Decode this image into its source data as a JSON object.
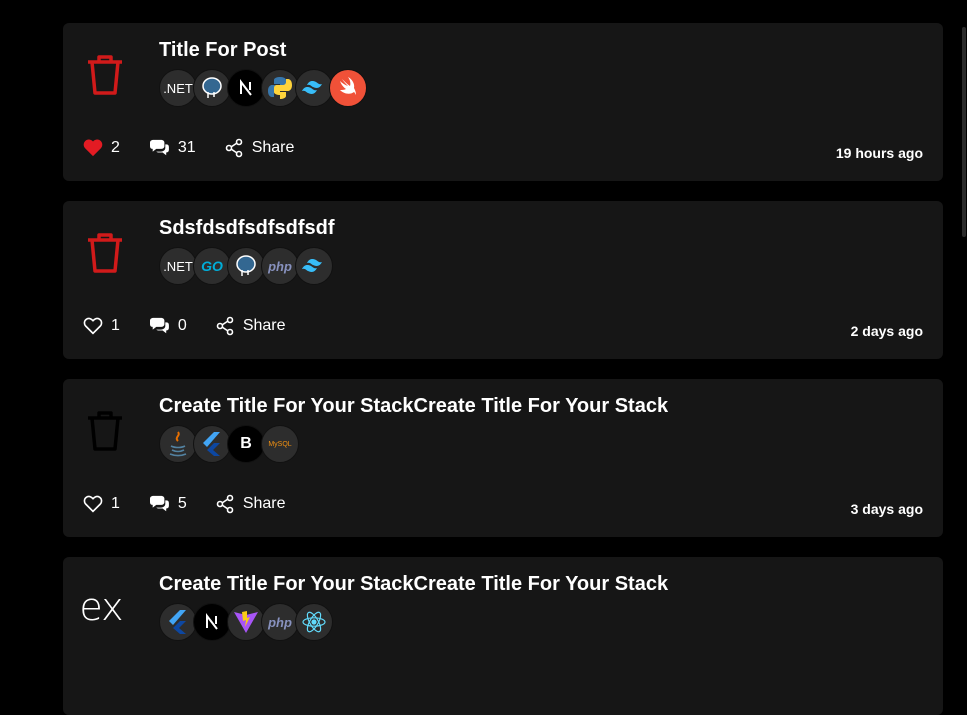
{
  "colors": {
    "background": "#000000",
    "card": "#161616",
    "badge": "#2d2d2d",
    "like_active": "#e31b23",
    "delete_active": "#d11a1a"
  },
  "posts": [
    {
      "title": "Title For Post",
      "leading_icon": "trash-icon-red",
      "stack": [
        {
          "name": "dotnet-badge",
          "text": ".NET"
        },
        {
          "name": "postgresql-badge",
          "text": ""
        },
        {
          "name": "nextjs-badge",
          "text": ""
        },
        {
          "name": "python-badge",
          "text": ""
        },
        {
          "name": "tailwind-badge",
          "text": ""
        },
        {
          "name": "swift-badge",
          "text": ""
        }
      ],
      "likes": "2",
      "liked": true,
      "comments": "31",
      "share_label": "Share",
      "time": "19 hours ago"
    },
    {
      "title": "Sdsfdsdfsdfsdfsdf",
      "leading_icon": "trash-icon-red",
      "stack": [
        {
          "name": "dotnet-badge",
          "text": ".NET"
        },
        {
          "name": "go-badge",
          "text": "GO"
        },
        {
          "name": "postgresql-badge",
          "text": ""
        },
        {
          "name": "php-badge",
          "text": "php"
        },
        {
          "name": "tailwind-badge",
          "text": ""
        }
      ],
      "likes": "1",
      "liked": false,
      "comments": "0",
      "share_label": "Share",
      "time": "2 days ago"
    },
    {
      "title": "Create Title For Your StackCreate Title For Your Stack",
      "leading_icon": "trash-icon-dark",
      "stack": [
        {
          "name": "java-badge",
          "text": ""
        },
        {
          "name": "flutter-badge",
          "text": ""
        },
        {
          "name": "bootstrap-badge",
          "text": "B"
        },
        {
          "name": "mysql-badge",
          "text": "MySQL"
        }
      ],
      "likes": "1",
      "liked": false,
      "comments": "5",
      "share_label": "Share",
      "time": "3 days ago"
    },
    {
      "title": "Create Title For Your StackCreate Title For Your Stack",
      "leading_icon": "express-logo",
      "leading_text": "ex",
      "stack": [
        {
          "name": "flutter-badge",
          "text": ""
        },
        {
          "name": "nextjs-badge",
          "text": ""
        },
        {
          "name": "vite-badge",
          "text": ""
        },
        {
          "name": "php-badge",
          "text": "php"
        },
        {
          "name": "react-badge",
          "text": ""
        }
      ]
    }
  ]
}
